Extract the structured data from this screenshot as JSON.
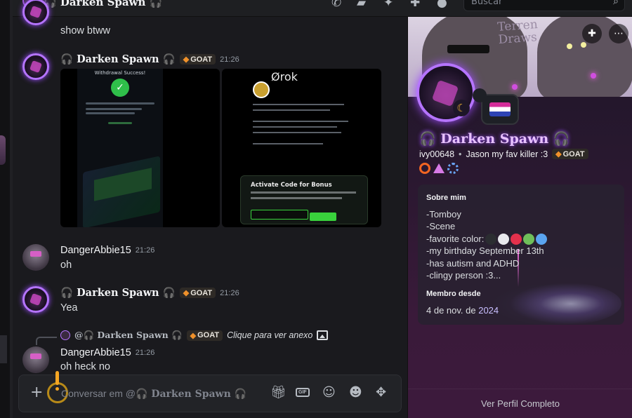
{
  "header": {
    "title": "🎧 Darken Spawn 🎧",
    "search_placeholder": "Buscar"
  },
  "messages": [
    {
      "kind": "text-only",
      "text": "show btww"
    },
    {
      "author": "🎧 Darken Spawn 🎧",
      "badge": "GOAT",
      "time": "21:26",
      "attachments": [
        {
          "name": "withdrawal-screenshot",
          "title": "Withdrawal Success!"
        },
        {
          "name": "grok-screenshot",
          "logo": "Ørok",
          "card_title": "Activate Code for Bonus"
        }
      ]
    },
    {
      "author": "DangerAbbie15",
      "time": "21:26",
      "text": "oh"
    },
    {
      "author": "🎧 Darken Spawn 🎧",
      "badge": "GOAT",
      "time": "21:26",
      "text": "Yea"
    },
    {
      "reply_to": {
        "author": "@🎧 Darken Spawn 🎧",
        "badge": "GOAT",
        "link": "Clique para ver anexo"
      },
      "author": "DangerAbbie15",
      "time": "21:26",
      "text": "oh heck no"
    }
  ],
  "composer": {
    "placeholder_prefix": "Conversar em @",
    "placeholder_target": "🎧 Darken Spawn 🎧",
    "icons": [
      "gift-icon",
      "gif-icon",
      "sticker-icon",
      "emoji-icon",
      "apps-icon"
    ],
    "gif_label": "GIF"
  },
  "profile": {
    "banner_sign": "Terren\nDraws",
    "display_name": "🎧 Darken Spawn 🎧",
    "username": "ivy00648",
    "pronouns": "Jason my fav killer :3",
    "badge": "GOAT",
    "about_title": "Sobre mim",
    "about_lines": [
      "-Tomboy",
      "-Scene",
      "-favorite color:",
      "-my birthday September 13th",
      "-has autism and ADHD",
      "-clingy person :3..."
    ],
    "favorite_colors": [
      "#2b2d31",
      "#e9e9ee",
      "#e3314c",
      "#6fbf5a",
      "#5aa4ef"
    ],
    "member_since_title": "Membro desde",
    "member_since_prefix": "4 de nov. de ",
    "member_since_year": "2024",
    "view_full": "Ver Perfil Completo"
  }
}
